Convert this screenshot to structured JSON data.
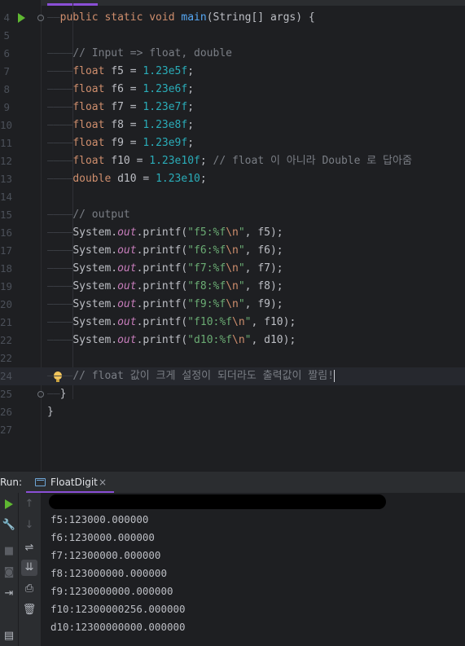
{
  "editor": {
    "lines": [
      {
        "n": "4",
        "indent": "——",
        "segments": [
          [
            "kw",
            "public static void "
          ],
          [
            "fn",
            "main"
          ],
          [
            "",
            "(String[] args) {"
          ]
        ],
        "run": true,
        "fold": true
      },
      {
        "n": "5",
        "indent": "",
        "segments": []
      },
      {
        "n": "6",
        "indent": "————",
        "segments": [
          [
            "cm",
            "// Input => float, double"
          ]
        ]
      },
      {
        "n": "7",
        "indent": "————",
        "segments": [
          [
            "kw",
            "float "
          ],
          [
            "",
            "f5 = "
          ],
          [
            "num",
            "1.23e5f"
          ],
          [
            "",
            ";"
          ]
        ]
      },
      {
        "n": "8",
        "indent": "————",
        "segments": [
          [
            "kw",
            "float "
          ],
          [
            "",
            "f6 = "
          ],
          [
            "num",
            "1.23e6f"
          ],
          [
            "",
            ";"
          ]
        ]
      },
      {
        "n": "9",
        "indent": "————",
        "segments": [
          [
            "kw",
            "float "
          ],
          [
            "",
            "f7 = "
          ],
          [
            "num",
            "1.23e7f"
          ],
          [
            "",
            ";"
          ]
        ]
      },
      {
        "n": "10",
        "indent": "————",
        "segments": [
          [
            "kw",
            "float "
          ],
          [
            "",
            "f8 = "
          ],
          [
            "num",
            "1.23e8f"
          ],
          [
            "",
            ";"
          ]
        ]
      },
      {
        "n": "11",
        "indent": "————",
        "segments": [
          [
            "kw",
            "float "
          ],
          [
            "",
            "f9 = "
          ],
          [
            "num",
            "1.23e9f"
          ],
          [
            "",
            ";"
          ]
        ]
      },
      {
        "n": "12",
        "indent": "————",
        "segments": [
          [
            "kw",
            "float "
          ],
          [
            "",
            "f10 = "
          ],
          [
            "num",
            "1.23e10f"
          ],
          [
            "",
            "; "
          ],
          [
            "cm",
            "// float 이 아니라 Double 로 답아줌"
          ]
        ]
      },
      {
        "n": "13",
        "indent": "————",
        "segments": [
          [
            "kw",
            "double "
          ],
          [
            "",
            "d10 = "
          ],
          [
            "num",
            "1.23e10"
          ],
          [
            "",
            ";"
          ]
        ]
      },
      {
        "n": "14",
        "indent": "",
        "segments": []
      },
      {
        "n": "15",
        "indent": "————",
        "segments": [
          [
            "cm",
            "// output"
          ]
        ]
      },
      {
        "n": "16",
        "indent": "————",
        "segments": [
          [
            "",
            "System."
          ],
          [
            "fld",
            "out"
          ],
          [
            "",
            ".printf("
          ],
          [
            "str",
            "\"f5:%f"
          ],
          [
            "esc",
            "\\n"
          ],
          [
            "str",
            "\""
          ],
          [
            "",
            ", f5);"
          ]
        ]
      },
      {
        "n": "17",
        "indent": "————",
        "segments": [
          [
            "",
            "System."
          ],
          [
            "fld",
            "out"
          ],
          [
            "",
            ".printf("
          ],
          [
            "str",
            "\"f6:%f"
          ],
          [
            "esc",
            "\\n"
          ],
          [
            "str",
            "\""
          ],
          [
            "",
            ", f6);"
          ]
        ]
      },
      {
        "n": "18",
        "indent": "————",
        "segments": [
          [
            "",
            "System."
          ],
          [
            "fld",
            "out"
          ],
          [
            "",
            ".printf("
          ],
          [
            "str",
            "\"f7:%f"
          ],
          [
            "esc",
            "\\n"
          ],
          [
            "str",
            "\""
          ],
          [
            "",
            ", f7);"
          ]
        ]
      },
      {
        "n": "19",
        "indent": "————",
        "segments": [
          [
            "",
            "System."
          ],
          [
            "fld",
            "out"
          ],
          [
            "",
            ".printf("
          ],
          [
            "str",
            "\"f8:%f"
          ],
          [
            "esc",
            "\\n"
          ],
          [
            "str",
            "\""
          ],
          [
            "",
            ", f8);"
          ]
        ]
      },
      {
        "n": "20",
        "indent": "————",
        "segments": [
          [
            "",
            "System."
          ],
          [
            "fld",
            "out"
          ],
          [
            "",
            ".printf("
          ],
          [
            "str",
            "\"f9:%f"
          ],
          [
            "esc",
            "\\n"
          ],
          [
            "str",
            "\""
          ],
          [
            "",
            ", f9);"
          ]
        ]
      },
      {
        "n": "21",
        "indent": "————",
        "segments": [
          [
            "",
            "System."
          ],
          [
            "fld",
            "out"
          ],
          [
            "",
            ".printf("
          ],
          [
            "str",
            "\"f10:%f"
          ],
          [
            "esc",
            "\\n"
          ],
          [
            "str",
            "\""
          ],
          [
            "",
            ", f10);"
          ]
        ]
      },
      {
        "n": "22",
        "indent": "————",
        "segments": [
          [
            "",
            "System."
          ],
          [
            "fld",
            "out"
          ],
          [
            "",
            ".printf("
          ],
          [
            "str",
            "\"d10:%f"
          ],
          [
            "esc",
            "\\n"
          ],
          [
            "str",
            "\""
          ],
          [
            "",
            ", d10);"
          ]
        ]
      },
      {
        "n": "22",
        "indent": "",
        "segments": []
      },
      {
        "n": "24",
        "indent": "————",
        "segments": [
          [
            "cm",
            "// float 값이 크게 설정이 되더라도 출력값이 짤림!"
          ]
        ],
        "current": true,
        "bulb": true
      },
      {
        "n": "25",
        "indent": "——",
        "segments": [
          [
            "",
            "}"
          ]
        ],
        "fold": true
      },
      {
        "n": "26",
        "indent": "",
        "segments": [
          [
            "",
            "}"
          ]
        ]
      },
      {
        "n": "27",
        "indent": "",
        "segments": []
      }
    ]
  },
  "run_panel": {
    "label": "Run:",
    "tab_title": "FloatDigit",
    "tab_close": "×",
    "output": [
      "f5:123000.000000",
      "f6:1230000.000000",
      "f7:12300000.000000",
      "f8:123000000.000000",
      "f9:1230000000.000000",
      "f10:12300000256.000000",
      "d10:12300000000.000000"
    ],
    "buttons": {
      "up": "↑",
      "down": "↓",
      "soft_wrap": "⇌",
      "scroll_end": "⇊",
      "print": "⎙",
      "delete": "🗑",
      "wrench": "🔧",
      "stop": "■",
      "camera": "◙",
      "exit": "⇥",
      "layout": "▤"
    }
  }
}
